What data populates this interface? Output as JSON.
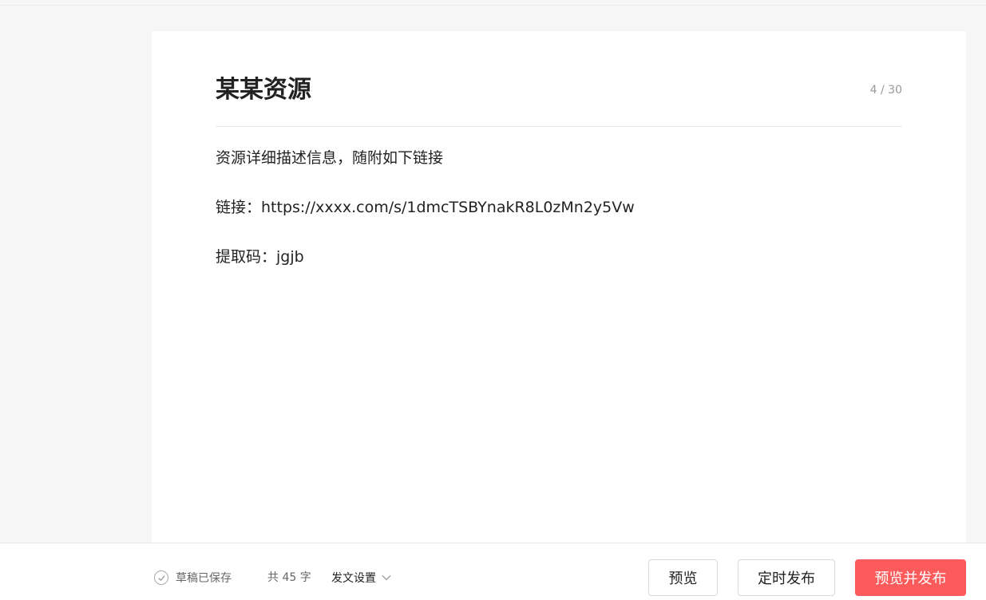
{
  "editor": {
    "title": "某某资源",
    "title_counter": "4 / 30",
    "content": [
      "资源详细描述信息，随附如下链接",
      "链接：https://xxxx.com/s/1dmcTSBYnakR8L0zMn2y5Vw",
      "提取码：jgjb"
    ]
  },
  "footer": {
    "save_status": "草稿已保存",
    "save_icon": "check-circle-icon",
    "word_count": "共 45 字",
    "settings_label": "发文设置",
    "settings_icon": "chevron-down-icon",
    "preview_label": "预览",
    "schedule_label": "定时发布",
    "publish_label": "预览并发布",
    "publish_color": "#fc5b5b"
  }
}
